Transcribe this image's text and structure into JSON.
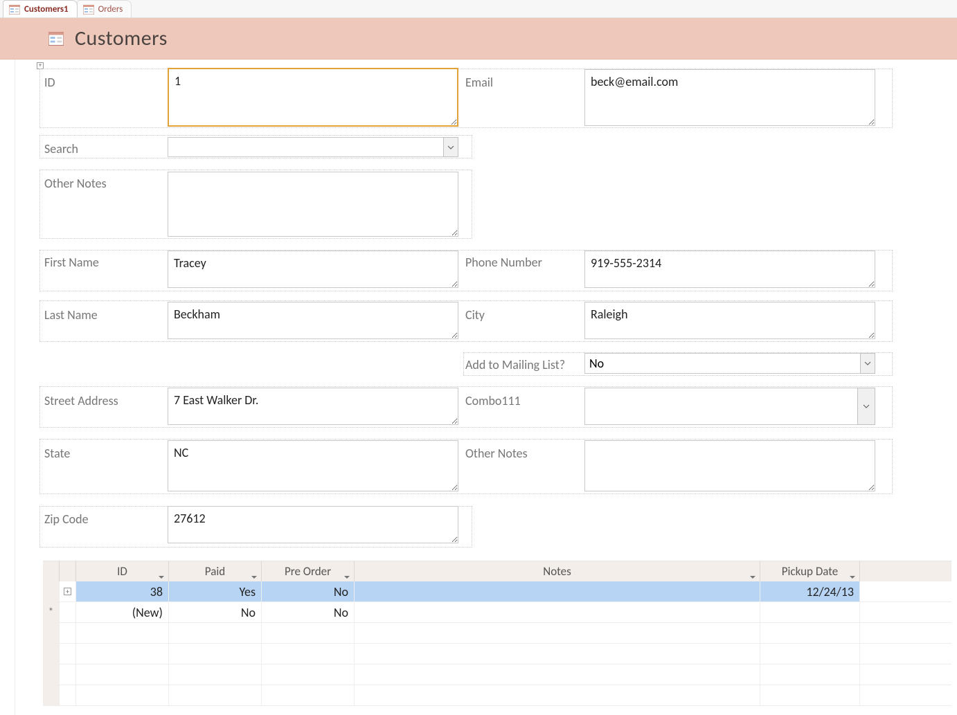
{
  "tabs": [
    {
      "label": "Customers1",
      "active": true
    },
    {
      "label": "Orders",
      "active": false
    }
  ],
  "header": {
    "title": "Customers"
  },
  "form": {
    "labels": {
      "id": "ID",
      "email": "Email",
      "search": "Search",
      "otherNotes1": "Other Notes",
      "firstName": "First Name",
      "phone": "Phone Number",
      "lastName": "Last Name",
      "city": "City",
      "mailing": "Add to Mailing List?",
      "street": "Street Address",
      "combo111": "Combo111",
      "state": "State",
      "otherNotes2": "Other Notes",
      "zip": "Zip Code"
    },
    "values": {
      "id": "1",
      "email": "beck@email.com",
      "search": "",
      "otherNotes1": "",
      "firstName": "Tracey",
      "phone": "919-555-2314",
      "lastName": "Beckham",
      "city": "Raleigh",
      "mailing": "No",
      "street": "7 East Walker Dr.",
      "combo111": "",
      "state": "NC",
      "otherNotes2": "",
      "zip": "27612"
    }
  },
  "subform": {
    "columns": [
      "ID",
      "Paid",
      "Pre Order",
      "Notes",
      "Pickup Date"
    ],
    "rows": [
      {
        "selector": "",
        "expand": "+",
        "id": "38",
        "paid": "Yes",
        "pre": "No",
        "notes": "",
        "date": "12/24/13",
        "selected": true
      },
      {
        "selector": "*",
        "expand": "",
        "id": "(New)",
        "paid": "No",
        "pre": "No",
        "notes": "",
        "date": "",
        "selected": false
      }
    ]
  }
}
